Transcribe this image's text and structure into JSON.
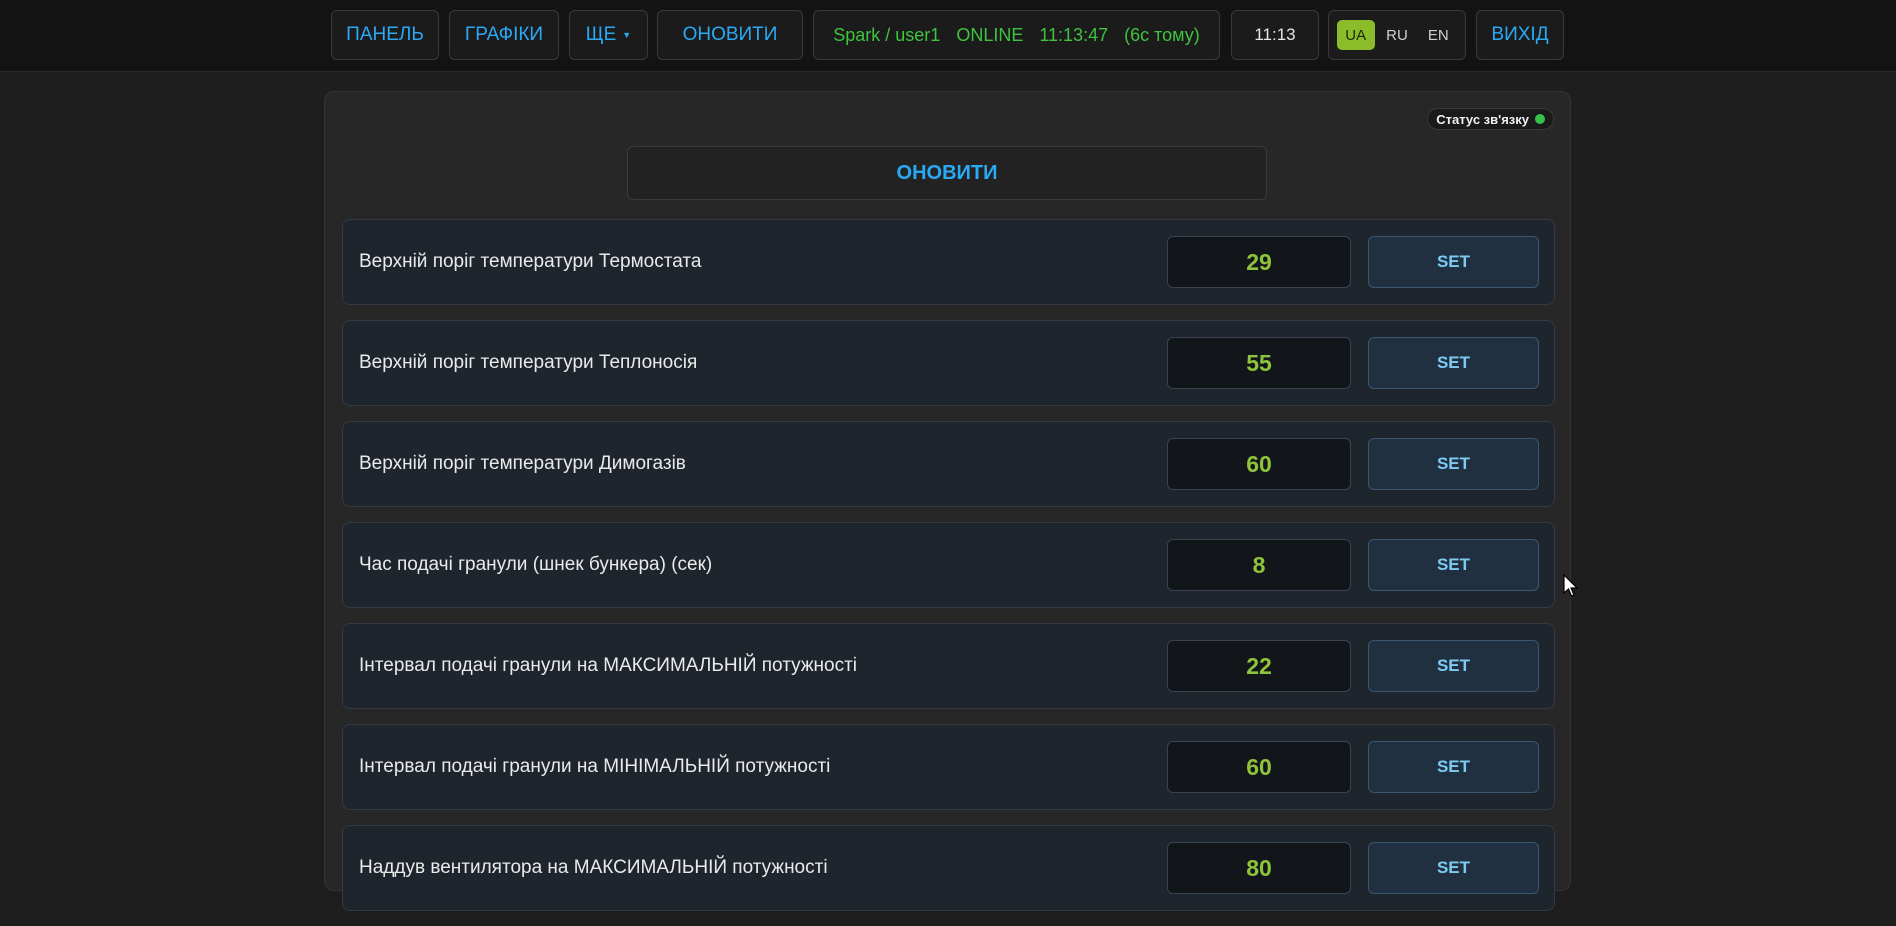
{
  "nav": {
    "panel": "ПАНЕЛЬ",
    "charts": "ГРАФІКИ",
    "more": "ЩЕ",
    "refresh": "ОНОВИТИ",
    "logout": "ВИХІД"
  },
  "status": {
    "device": "Spark / user1",
    "state": "ONLINE",
    "time": "11:13:47",
    "ago": "(6с тому)"
  },
  "clock": "11:13",
  "languages": [
    {
      "code": "UA",
      "active": true
    },
    {
      "code": "RU",
      "active": false
    },
    {
      "code": "EN",
      "active": false
    }
  ],
  "panel": {
    "link_status": "Статус зв'язку",
    "link_color": "#36c24a",
    "refresh_button": "ОНОВИТИ"
  },
  "settings": [
    {
      "label": "Верхній поріг температури Термостата",
      "value": "29",
      "button": "SET"
    },
    {
      "label": "Верхній поріг температури Теплоносія",
      "value": "55",
      "button": "SET"
    },
    {
      "label": "Верхній поріг температури Димогазів",
      "value": "60",
      "button": "SET"
    },
    {
      "label": "Час подачі гранули (шнек бункера) (сек)",
      "value": "8",
      "button": "SET"
    },
    {
      "label": "Інтервал подачі гранули на МАКСИМАЛЬНІЙ потужності",
      "value": "22",
      "button": "SET"
    },
    {
      "label": "Інтервал подачі гранули на МІНІМАЛЬНІЙ потужності",
      "value": "60",
      "button": "SET"
    },
    {
      "label": "Наддув вентилятора на МАКСИМАЛЬНІЙ потужності",
      "value": "80",
      "button": "SET"
    }
  ],
  "colors": {
    "accent": "#2aa9f5",
    "online": "#3ec43e",
    "value": "#8dc43a",
    "lang_active": "#8bbd2a"
  }
}
